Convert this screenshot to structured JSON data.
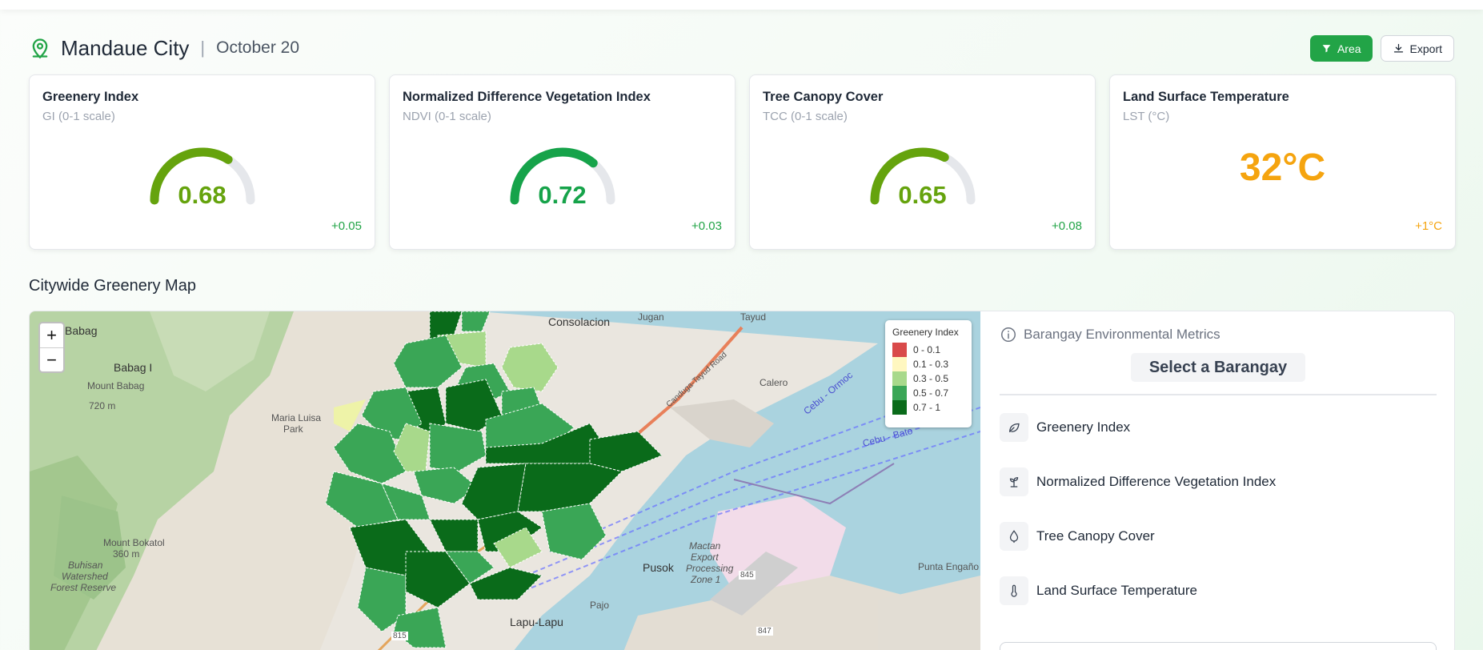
{
  "header": {
    "city": "Mandaue City",
    "separator": "|",
    "date": "October 20"
  },
  "actions": {
    "area_label": "Area",
    "export_label": "Export"
  },
  "cards": [
    {
      "title": "Greenery Index",
      "subtitle": "GI (0-1 scale)",
      "value": "0.68",
      "fraction": 0.68,
      "delta": "+0.05",
      "color": "#65a30d",
      "delta_color": "#22a447"
    },
    {
      "title": "Normalized Difference Vegetation Index",
      "subtitle": "NDVI (0-1 scale)",
      "value": "0.72",
      "fraction": 0.72,
      "delta": "+0.03",
      "color": "#16a34a",
      "delta_color": "#22a447"
    },
    {
      "title": "Tree Canopy Cover",
      "subtitle": "TCC (0-1 scale)",
      "value": "0.65",
      "fraction": 0.65,
      "delta": "+0.08",
      "color": "#65a30d",
      "delta_color": "#22a447"
    },
    {
      "title": "Land Surface Temperature",
      "subtitle": "LST (°C)",
      "value": "32°C",
      "delta": "+1°C",
      "color": "#f5a40f",
      "delta_color": "#f5a40f"
    }
  ],
  "section_title": "Citywide Greenery Map",
  "map": {
    "zoom_in": "+",
    "zoom_out": "−",
    "labels": [
      "Babag",
      "Babag I",
      "Mount Babag",
      "720 m",
      "Maria Luisa",
      "Park",
      "Consolacion",
      "Jugan",
      "Tayud",
      "Calero",
      "Mount Bokatol",
      "360 m",
      "Buhisan",
      "Watershed",
      "Forest Reserve",
      "Pusok",
      "Pajo",
      "Lapu-Lapu",
      "Mactan",
      "Export",
      "Processing",
      "Zone 1",
      "Punta Engaño",
      "Cebu - Bato",
      "Cebu - Ormoc",
      "Canduga-Tayud Road",
      "815",
      "845",
      "847"
    ],
    "legend": {
      "title": "Greenery Index",
      "items": [
        {
          "label": "0 - 0.1",
          "color": "#d94a4a"
        },
        {
          "label": "0.1 - 0.3",
          "color": "#fff7c0"
        },
        {
          "label": "0.3 - 0.5",
          "color": "#a8d98b"
        },
        {
          "label": "0.5 - 0.7",
          "color": "#3aa656"
        },
        {
          "label": "0.7 - 1",
          "color": "#0a6b1a"
        }
      ]
    }
  },
  "sidepanel": {
    "header": "Barangay Environmental Metrics",
    "select_label": "Select a Barangay",
    "metrics": [
      {
        "label": "Greenery Index",
        "icon": "leaf-icon"
      },
      {
        "label": "Normalized Difference Vegetation Index",
        "icon": "sprout-icon"
      },
      {
        "label": "Tree Canopy Cover",
        "icon": "tree-icon"
      },
      {
        "label": "Land Surface Temperature",
        "icon": "thermometer-icon"
      }
    ]
  }
}
